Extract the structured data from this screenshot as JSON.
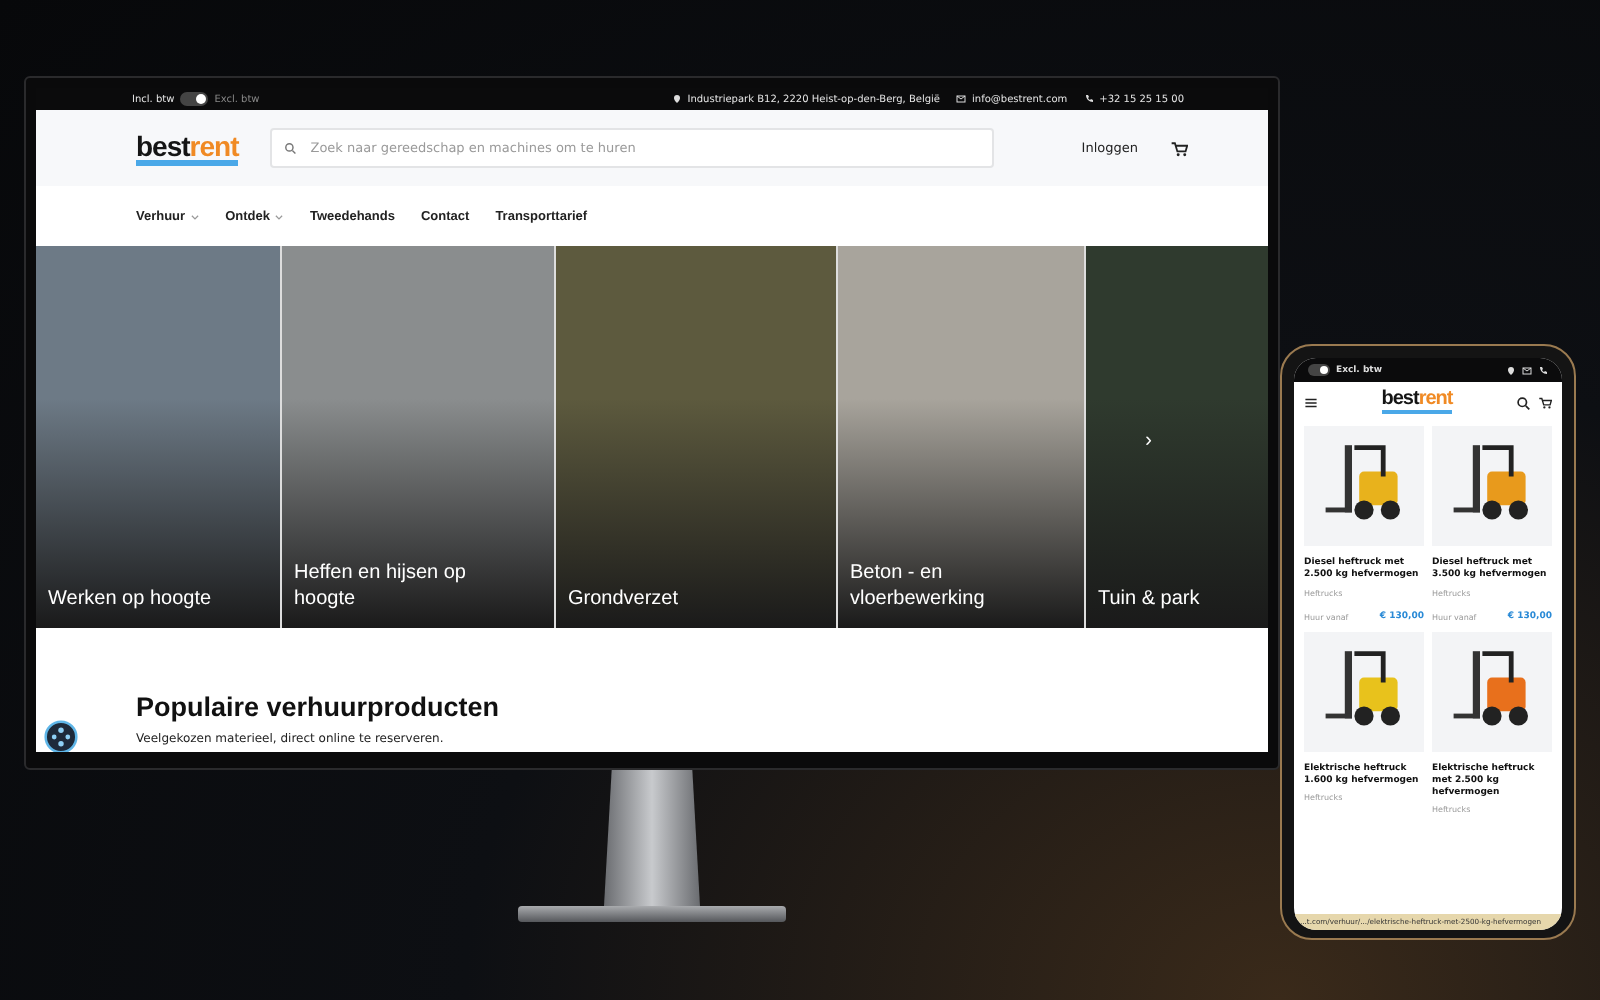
{
  "monitor": {
    "top_bar": {
      "vat_toggle": {
        "left_label": "Incl. btw",
        "right_label": "Excl. btw",
        "on": true
      },
      "address": "Industriepark B12, 2220 Heist-op-den-Berg, België",
      "email": "info@bestrent.com",
      "phone": "+32 15 25 15 00"
    },
    "header": {
      "logo": {
        "part_1": "best",
        "part_2": "rent"
      },
      "search": {
        "placeholder": "Zoek naar gereedschap en machines om te huren"
      },
      "login": "Inloggen"
    },
    "nav": [
      {
        "label": "Verhuur",
        "dropdown": true
      },
      {
        "label": "Ontdek",
        "dropdown": true
      },
      {
        "label": "Tweedehands",
        "dropdown": false
      },
      {
        "label": "Contact",
        "dropdown": false
      },
      {
        "label": "Transporttarief",
        "dropdown": false
      }
    ],
    "categories": [
      {
        "label": "Werken op hoogte"
      },
      {
        "label": "Heffen en hijsen op hoogte"
      },
      {
        "label": "Grondverzet"
      },
      {
        "label": "Beton - en vloerbewerking"
      },
      {
        "label": "Tuin & park"
      }
    ],
    "carousel_next": "›",
    "section": {
      "title": "Populaire verhuurproducten",
      "subtitle": "Veelgekozen materieel, direct online te reserveren."
    }
  },
  "phone": {
    "vat_toggle": {
      "label": "Excl. btw",
      "on": true
    },
    "logo": {
      "part_1": "best",
      "part_2": "rent"
    },
    "products": [
      {
        "title": "Diesel heftruck met 2.500 kg hefvermogen",
        "category": "Heftrucks",
        "price_label": "Huur vanaf",
        "price": "€ 130,00",
        "color": "#e8b21c"
      },
      {
        "title": "Diesel heftruck met 3.500 kg hefvermogen",
        "category": "Heftrucks",
        "price_label": "Huur vanaf",
        "price": "€ 130,00",
        "color": "#e89a1c"
      },
      {
        "title": "Elektrische heftruck 1.600 kg hefvermogen",
        "category": "Heftrucks",
        "color": "#e8c21c"
      },
      {
        "title": "Elektrische heftruck met 2.500 kg hefvermogen",
        "category": "Heftrucks",
        "color": "#e8701c"
      }
    ],
    "status_url": "...t.com/verhuur/.../elektrische-heftruck-met-2500-kg-hefvermogen"
  }
}
